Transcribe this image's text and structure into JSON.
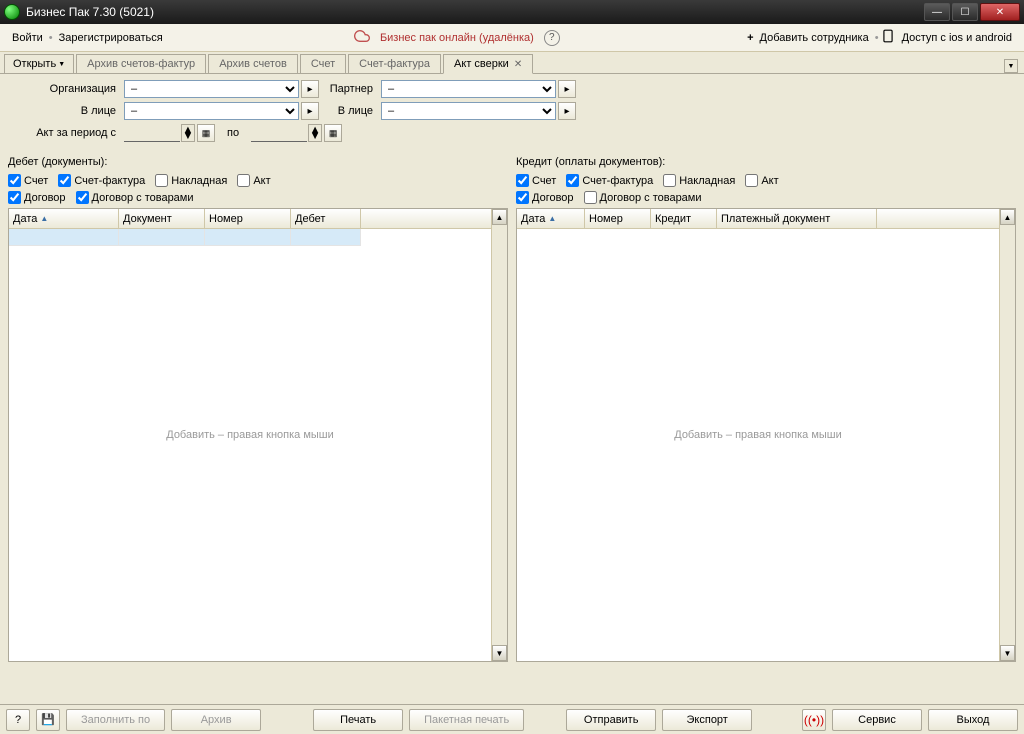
{
  "window": {
    "title": "Бизнес Пак 7.30 (5021)"
  },
  "linksbar": {
    "login": "Войти",
    "register": "Зарегистрироваться",
    "online": "Бизнес пак онлайн (удалёнка)",
    "add_emp": "Добавить сотрудника",
    "access": "Доступ с ios и android"
  },
  "tabs": {
    "open": "Открыть",
    "items": [
      {
        "label": "Архив счетов-фактур"
      },
      {
        "label": "Архив счетов"
      },
      {
        "label": "Счет"
      },
      {
        "label": "Счет-фактура"
      },
      {
        "label": "Акт сверки",
        "closable": true
      }
    ]
  },
  "form": {
    "org_label": "Организация",
    "org_value": "–",
    "partner_label": "Партнер",
    "partner_value": "–",
    "person1_label": "В лице",
    "person1_value": "–",
    "person2_label": "В лице",
    "person2_value": "–",
    "period_label": "Акт за период с",
    "date1": "",
    "date1_spin": "1",
    "date_to": "по",
    "date2": "",
    "date2_spin": "1"
  },
  "debit": {
    "title": "Дебет (документы):",
    "chk_invoice": "Счет",
    "chk_factura": "Счет-фактура",
    "chk_waybill": "Накладная",
    "chk_act": "Акт",
    "chk_contract": "Договор",
    "chk_contract_goods": "Договор с товарами",
    "cols": {
      "date": "Дата",
      "doc": "Документ",
      "num": "Номер",
      "debit": "Дебет"
    },
    "placeholder": "Добавить – правая кнопка мыши"
  },
  "credit": {
    "title": "Кредит (оплаты документов):",
    "chk_invoice": "Счет",
    "chk_factura": "Счет-фактура",
    "chk_waybill": "Накладная",
    "chk_act": "Акт",
    "chk_contract": "Договор",
    "chk_contract_goods": "Договор с товарами",
    "cols": {
      "date": "Дата",
      "num": "Номер",
      "credit": "Кредит",
      "paydoc": "Платежный документ"
    },
    "placeholder": "Добавить – правая кнопка мыши"
  },
  "bottom": {
    "fill_by": "Заполнить по",
    "archive": "Архив",
    "print": "Печать",
    "batch_print": "Пакетная печать",
    "send": "Отправить",
    "export": "Экспорт",
    "service": "Сервис",
    "exit": "Выход"
  }
}
